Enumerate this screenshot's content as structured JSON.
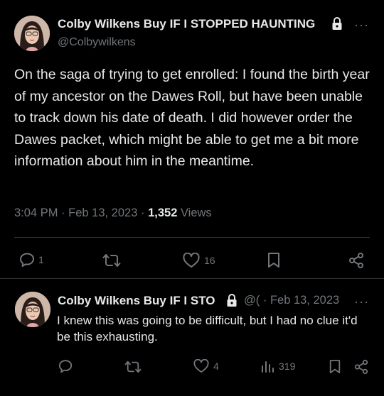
{
  "tweet": {
    "author_name": "Colby Wilkens Buy IF I STOPPED HAUNTING",
    "handle": "@Colbywilkens",
    "text": "On the saga of trying to get enrolled: I found the birth year of my ancestor on the Dawes Roll, but have been unable to track down his date of death. I did however order the Dawes packet, which might be able to get me a bit more information about him in the meantime.",
    "time": "3:04 PM",
    "date": "Feb 13, 2023",
    "views_count": "1,352",
    "views_label": "Views",
    "replies": "1",
    "likes": "16"
  },
  "reply": {
    "author_name": "Colby Wilkens Buy IF I STO",
    "handle": "@(",
    "date": "Feb 13, 2023",
    "text": "I knew this was going to be difficult, but I had no clue it'd be this exhausting.",
    "likes": "4",
    "views": "319"
  },
  "ui": {
    "sep": "·",
    "more": "···"
  },
  "colors": {
    "background": "#000000",
    "text": "#e7e9ea",
    "muted": "#71767b",
    "divider": "#2f3336"
  }
}
